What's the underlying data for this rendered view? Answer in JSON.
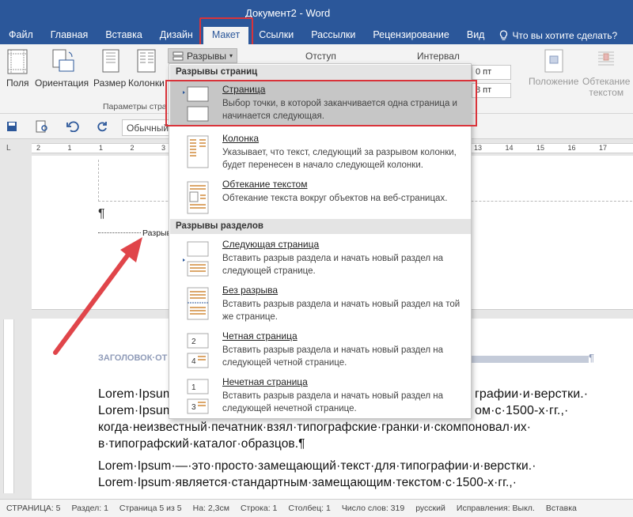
{
  "window": {
    "title": "Документ2 - Word"
  },
  "tabs": [
    {
      "label": "Файл"
    },
    {
      "label": "Главная"
    },
    {
      "label": "Вставка"
    },
    {
      "label": "Дизайн"
    },
    {
      "label": "Макет"
    },
    {
      "label": "Ссылки"
    },
    {
      "label": "Рассылки"
    },
    {
      "label": "Рецензирование"
    },
    {
      "label": "Вид"
    }
  ],
  "tellme": {
    "label": "Что вы хотите сделать?"
  },
  "ribbon": {
    "fields": "Поля",
    "orientation": "Ориентация",
    "size": "Размер",
    "columns": "Колонки",
    "group_label": "Параметры стра",
    "breaks": "Разрывы",
    "indent": "Отступ",
    "spacing": "Интервал",
    "spin1": "0 пт",
    "spin2": "8 пт",
    "position": "Положение",
    "wrap": "Обтекание\nтекстом"
  },
  "qat": {
    "style": "Обычный"
  },
  "ruler": {
    "marks": [
      "2",
      "1",
      "1",
      "2",
      "3",
      "4",
      "5",
      "6",
      "7",
      "8",
      "9",
      "10",
      "11",
      "12",
      "13",
      "14",
      "15",
      "16",
      "17"
    ]
  },
  "doc": {
    "pilcrow": "¶",
    "break_label": "Разрыв",
    "heading": "ЗАГОЛОВОК·ОТ",
    "heading_mark": "¶",
    "p1_line1a": "Lorem·Ipsum",
    "p1_line1b": "графии·и·верстки.·",
    "p1_line2a": "Lorem·Ipsum",
    "p1_line2b": "ом·с·1500-х·гг.,·",
    "p1_line3": "когда·неизвестный·печатник·взял·типографские·гранки·и·скомпоновал·их·",
    "p1_line4": "в·типографский·каталог·образцов.¶",
    "p2_line1": "Lorem·Ipsum·—·это·просто·замещающий·текст·для·типографии·и·верстки.·",
    "p2_line2": "Lorem·Ipsum·является·стандартным·замещающим·текстом·с·1500-х·гг.,·"
  },
  "menu": {
    "section1": "Разрывы страниц",
    "section2": "Разрывы разделов",
    "items": [
      {
        "title": "Страница",
        "desc": "Выбор точки, в которой заканчивается одна страница и начинается следующая."
      },
      {
        "title": "Колонка",
        "desc": "Указывает, что текст, следующий за разрывом колонки, будет перенесен в начало следующей колонки."
      },
      {
        "title": "Обтекание текстом",
        "desc": "Обтекание текста вокруг объектов на веб-страницах."
      },
      {
        "title": "Следующая страница",
        "desc": "Вставить разрыв раздела и начать новый раздел на следующей странице."
      },
      {
        "title": "Без разрыва",
        "desc": "Вставить разрыв раздела и начать новый раздел на той же странице."
      },
      {
        "title": "Четная страница",
        "desc": "Вставить разрыв раздела и начать новый раздел на следующей четной странице."
      },
      {
        "title": "Нечетная страница",
        "desc": "Вставить разрыв раздела и начать новый раздел на следующей нечетной странице."
      }
    ]
  },
  "status": {
    "page": "СТРАНИЦА: 5",
    "section": "Раздел: 1",
    "pages": "Страница 5 из 5",
    "at": "На: 2,3см",
    "line": "Строка: 1",
    "col": "Столбец: 1",
    "words": "Число слов: 319",
    "lang": "русский",
    "track": "Исправления: Выкл.",
    "insert": "Вставка"
  },
  "colors": {
    "accent": "#2b579a",
    "highlight": "#d9333a",
    "arrow": "#e0454a",
    "heading": "#8f9bb8"
  }
}
